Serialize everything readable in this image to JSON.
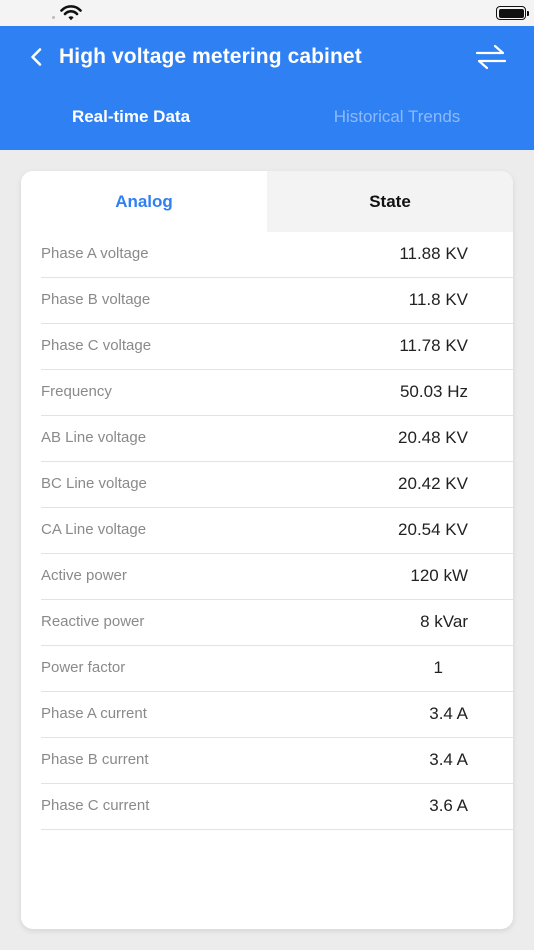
{
  "status_bar": {
    "wifi": "wifi-icon",
    "battery": "battery-icon"
  },
  "header": {
    "title": "High voltage metering cabinet",
    "back_icon": "chevron-left-icon",
    "switch_icon": "swap-arrows-icon",
    "background_color": "#2f80f3",
    "tabs": [
      {
        "label": "Real-time Data",
        "active": true
      },
      {
        "label": "Historical Trends",
        "active": false
      }
    ]
  },
  "segments": [
    {
      "label": "Analog",
      "active": true
    },
    {
      "label": "State",
      "active": false
    }
  ],
  "rows": [
    {
      "label": "Phase A voltage",
      "value": "11.88 KV"
    },
    {
      "label": "Phase B voltage",
      "value": "11.8 KV"
    },
    {
      "label": "Phase C voltage",
      "value": "11.78 KV"
    },
    {
      "label": "Frequency",
      "value": "50.03 Hz"
    },
    {
      "label": "AB Line voltage",
      "value": "20.48 KV"
    },
    {
      "label": "BC Line voltage",
      "value": "20.42 KV"
    },
    {
      "label": "CA Line voltage",
      "value": "20.54 KV"
    },
    {
      "label": "Active power",
      "value": "120 kW"
    },
    {
      "label": "Reactive power",
      "value": "8 kVar"
    },
    {
      "label": "Power factor",
      "value": "1"
    },
    {
      "label": "Phase A current",
      "value": "3.4 A"
    },
    {
      "label": "Phase B current",
      "value": "3.4 A"
    },
    {
      "label": "Phase C current",
      "value": "3.6 A"
    }
  ]
}
